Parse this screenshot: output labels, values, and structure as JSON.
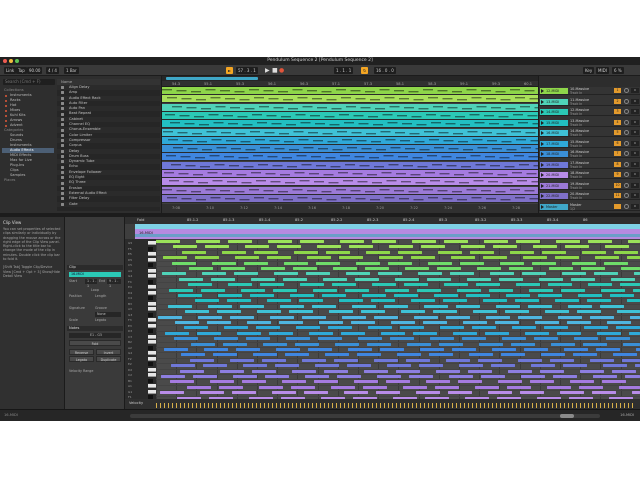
{
  "window": {
    "title": "Pendulum Sequence 2 [Pendulum Sequence 2]"
  },
  "transport": {
    "link": "Link",
    "tap": "Tap",
    "tempo": "90.00",
    "meter": "4 / 4",
    "quant": "1 Bar",
    "position": "57 . 3 . 1",
    "loop_start": "1 . 1 . 1",
    "loop_len": "16 . 0 . 0",
    "key": "Key",
    "midi": "MIDI",
    "cpu": "6 %",
    "accent_color": "#f5a623"
  },
  "browser": {
    "search_placeholder": "Search (Cmd + F)",
    "collections_head": "Collections",
    "categories_head": "Categories",
    "places_head": "Places",
    "collections": [
      "Instruments",
      "Racks",
      "Hot",
      "Mixes",
      "Kuhl Kits",
      "Arrows",
      "Advent"
    ],
    "categories": [
      "Sounds",
      "Drums",
      "Instruments",
      "Audio Effects",
      "MIDI Effects",
      "Max for Live",
      "Plug-Ins",
      "Clips",
      "Samples"
    ],
    "selected_category": "Audio Effects",
    "list_header": "Name",
    "items": [
      "Align Delay",
      "Amp",
      "Audio Effect Rack",
      "Auto Filter",
      "Auto Pan",
      "Beat Repeat",
      "Cabinet",
      "Channel EQ",
      "Chorus-Ensemble",
      "Color Limiter",
      "Compressor",
      "Corpus",
      "Delay",
      "Drum Buss",
      "Dynamic Tube",
      "Echo",
      "Envelope Follower",
      "EQ Eight",
      "EQ Three",
      "Erosion",
      "External Audio Effect",
      "Filter Delay",
      "Gate"
    ]
  },
  "arrangement": {
    "ruler": [
      "54.3",
      "55.1",
      "55.3",
      "56.1",
      "56.3",
      "57.1",
      "57.3",
      "58.1",
      "58.3",
      "59.1",
      "59.3",
      "60.1"
    ],
    "timeline": [
      "7:08",
      "7:10",
      "7:12",
      "7:14",
      "7:16",
      "7:18",
      "7:20",
      "7:22",
      "7:24",
      "7:26",
      "7:28"
    ],
    "track_colors": [
      "#8ed64a",
      "#a8e05a",
      "#4fd3b8",
      "#2bc9b6",
      "#22bfc2",
      "#3fc2d6",
      "#2fa9d8",
      "#3a8fd6",
      "#3f86e0",
      "#6f78d8",
      "#a57be0",
      "#b88ce8",
      "#9b7ad6",
      "#7f70c8"
    ]
  },
  "mixer": {
    "tracks": [
      {
        "clip": "12-MIDI",
        "name": "10-Massive",
        "sub": "Track In",
        "num": "1",
        "vol": "0",
        "color": "#8ed64a"
      },
      {
        "clip": "13-MIDI",
        "name": "11-Massive",
        "sub": "Track In",
        "num": "2",
        "vol": "0",
        "color": "#4fd3b8"
      },
      {
        "clip": "14-MIDI",
        "name": "12-Massive",
        "sub": "Track In",
        "num": "3",
        "vol": "0",
        "color": "#2bc9b6"
      },
      {
        "clip": "15-MIDI",
        "name": "13-Massive",
        "sub": "Track In",
        "num": "4",
        "vol": "0",
        "color": "#22bfc2"
      },
      {
        "clip": "16-MIDI",
        "name": "14-Massive",
        "sub": "Track In",
        "num": "5",
        "vol": "0",
        "color": "#3fc2d6"
      },
      {
        "clip": "17-MIDI",
        "name": "15-Massive",
        "sub": "Track In",
        "num": "6",
        "vol": "0",
        "color": "#2fa9d8"
      },
      {
        "clip": "18-MIDI",
        "name": "16-Massive",
        "sub": "Track In",
        "num": "7",
        "vol": "0",
        "color": "#3a8fd6"
      },
      {
        "clip": "19-MIDI",
        "name": "17-Massive",
        "sub": "Track In",
        "num": "8",
        "vol": "0",
        "color": "#6f78d8"
      },
      {
        "clip": "20-MIDI",
        "name": "18-Massive",
        "sub": "Track In",
        "num": "9",
        "vol": "0",
        "color": "#b88ce8"
      },
      {
        "clip": "21-MIDI",
        "name": "19-Massive",
        "sub": "Track In",
        "num": "10",
        "vol": "0",
        "color": "#9b7ad6"
      },
      {
        "clip": "22-MIDI",
        "name": "20-Massive",
        "sub": "Track In",
        "num": "11",
        "vol": "0",
        "color": "#7f70c8"
      },
      {
        "clip": "Master",
        "name": "Master",
        "sub": "1/2",
        "num": "",
        "vol": "0",
        "color": "#3fa7c7"
      }
    ]
  },
  "info": {
    "title": "Clip View",
    "text": "You can set properties of selected clips similarly or individually by dragging the mouse across or the right edge of the Clip View panel. Right-click to the title bar to change the mode of the clip in minutes. Double click the clip bar to fold it.",
    "shortcut": "[Shift Tab] Toggle Clip/Device View [Cmd + Opt + 3] Show/Hide Detail View"
  },
  "clipview": {
    "clip_head": "Clip",
    "clip_name": "16-MIDI",
    "start_label": "Start",
    "start_value": "1 . 1 . 1",
    "end_label": "End",
    "end_value": "9 . 1 . 1",
    "loop_label": "Loop",
    "position_label": "Position",
    "length_label": "Length",
    "signature_label": "Signature",
    "groove_label": "Groove",
    "none_label": "None",
    "scale_label": "Scale",
    "legato_label": "Legato",
    "notes_head": "Notes",
    "pitch_range": "E1 - G5",
    "fold_label": "Fold",
    "reverse_label": "Reverse",
    "invert_label": "Invert",
    "duplicate_label": "Duplicate",
    "velocity_label": "Velocity Range"
  },
  "pianoroll": {
    "fold": "Fold",
    "scale": "Scale",
    "ruler": [
      "85.1.2",
      "85.1.3",
      "85.1.4",
      "85.2",
      "85.2.2",
      "85.2.3",
      "85.2.4",
      "85.3",
      "85.3.2",
      "85.3.3",
      "85.3.4",
      "86"
    ],
    "clip_label": "16-MIDI",
    "keys": [
      "G5",
      "F5",
      "E5",
      "D5",
      "C5",
      "A4",
      "G4",
      "F4",
      "E4",
      "D4",
      "C4",
      "B3",
      "A3",
      "G3",
      "F3",
      "E3",
      "D3",
      "C3",
      "B2",
      "A2",
      "G2",
      "F2",
      "E2",
      "D2",
      "C2",
      "B1",
      "A1",
      "G1",
      "F1",
      "E1"
    ],
    "note_colors": [
      "#9be25a",
      "#8ed64a",
      "#6fdc6a",
      "#4fd3b8",
      "#2bc9b6",
      "#22bfc2",
      "#3fc2d6",
      "#4fb5e0",
      "#2fa9d8",
      "#3a8fd6",
      "#3f86e0",
      "#6f78d8",
      "#8d7ee0",
      "#a57be0",
      "#b88ce8"
    ],
    "vel_label": "Velocity",
    "vel_value": "127"
  },
  "status": {
    "left": "16-MIDI",
    "zoom": "16-MIDI"
  }
}
